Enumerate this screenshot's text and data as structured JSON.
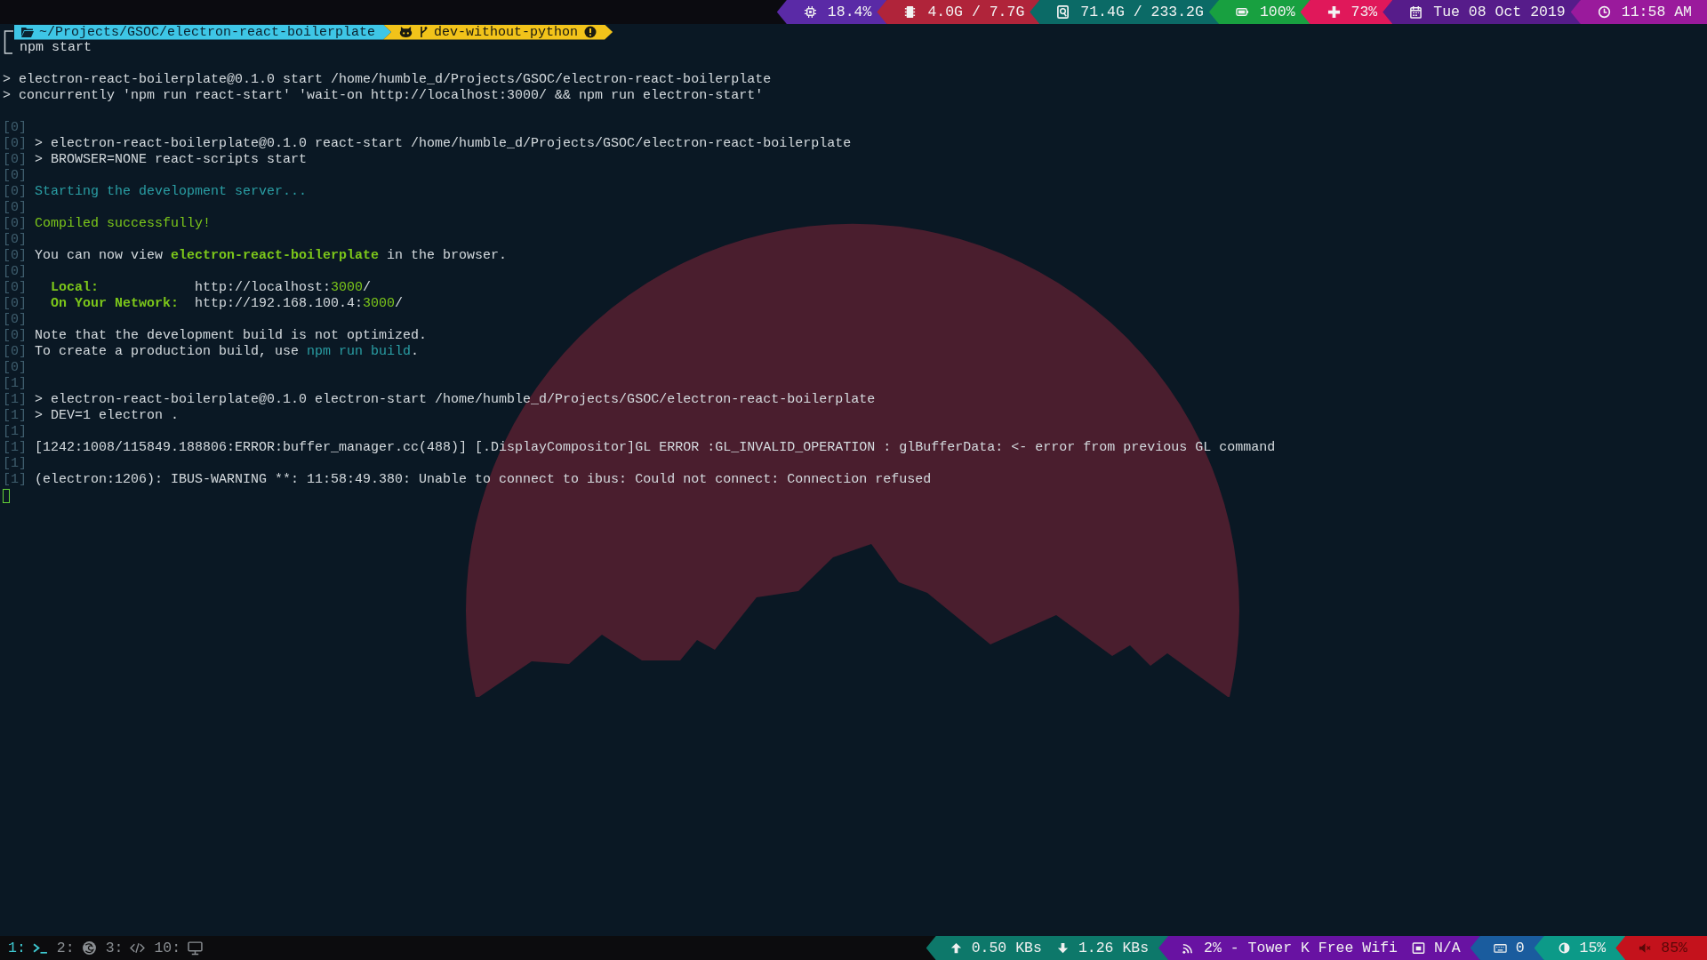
{
  "top_bar": {
    "segments": [
      {
        "kind": "cpu",
        "text": "18.4%",
        "color": "#5a2aa6"
      },
      {
        "kind": "memory",
        "text": "4.0G / 7.7G",
        "color": "#b0243a"
      },
      {
        "kind": "disk",
        "text": "71.4G / 233.2G",
        "color": "#0b6a66"
      },
      {
        "kind": "battery",
        "text": "100%",
        "color": "#18a040"
      },
      {
        "kind": "health",
        "text": "73%",
        "color": "#e0185a"
      },
      {
        "kind": "calendar",
        "text": "Tue 08 Oct 2019",
        "color": "#561c8a"
      },
      {
        "kind": "clock",
        "text": "11:58 AM",
        "color": "#9a1a9c"
      }
    ]
  },
  "prompt": {
    "path": "~/Projects/GSOC/electron-react-boilerplate",
    "branch": "dev-without-python",
    "dirty": true,
    "command": "npm start"
  },
  "terminal": {
    "lines": [
      {
        "kind": "blank"
      },
      {
        "kind": "output",
        "segments": [
          {
            "text": "> electron-react-boilerplate@0.1.0 start /home/humble_d/Projects/GSOC/electron-react-boilerplate",
            "kind": "plain"
          }
        ]
      },
      {
        "kind": "output",
        "segments": [
          {
            "text": "> concurrently 'npm run react-start' 'wait-on http://localhost:3000/ && npm run electron-start'",
            "kind": "plain"
          }
        ]
      },
      {
        "kind": "blank"
      },
      {
        "kind": "output",
        "tag": "[0]"
      },
      {
        "kind": "output",
        "tag": "[0]",
        "segments": [
          {
            "text": "> electron-react-boilerplate@0.1.0 react-start /home/humble_d/Projects/GSOC/electron-react-boilerplate",
            "kind": "plain"
          }
        ]
      },
      {
        "kind": "output",
        "tag": "[0]",
        "segments": [
          {
            "text": "> BROWSER=NONE react-scripts start",
            "kind": "plain"
          }
        ]
      },
      {
        "kind": "output",
        "tag": "[0]"
      },
      {
        "kind": "output",
        "tag": "[0]",
        "segments": [
          {
            "text": "Starting the development server...",
            "kind": "info"
          }
        ]
      },
      {
        "kind": "output",
        "tag": "[0]"
      },
      {
        "kind": "output",
        "tag": "[0]",
        "segments": [
          {
            "text": "Compiled successfully!",
            "kind": "success"
          }
        ]
      },
      {
        "kind": "output",
        "tag": "[0]"
      },
      {
        "kind": "output",
        "tag": "[0]",
        "segments": [
          {
            "text": "You can now view ",
            "kind": "plain"
          },
          {
            "text": "electron-react-boilerplate",
            "kind": "highlight"
          },
          {
            "text": " in the browser.",
            "kind": "plain"
          }
        ]
      },
      {
        "kind": "output",
        "tag": "[0]"
      },
      {
        "kind": "output",
        "tag": "[0]",
        "segments": [
          {
            "text": "  Local:",
            "kind": "highlight"
          },
          {
            "text": "            http://localhost:",
            "kind": "plain"
          },
          {
            "text": "3000",
            "kind": "success"
          },
          {
            "text": "/",
            "kind": "plain"
          }
        ]
      },
      {
        "kind": "output",
        "tag": "[0]",
        "segments": [
          {
            "text": "  On Your Network:",
            "kind": "highlight"
          },
          {
            "text": "  http://192.168.100.4:",
            "kind": "plain"
          },
          {
            "text": "3000",
            "kind": "success"
          },
          {
            "text": "/",
            "kind": "plain"
          }
        ]
      },
      {
        "kind": "output",
        "tag": "[0]"
      },
      {
        "kind": "output",
        "tag": "[0]",
        "segments": [
          {
            "text": "Note that the development build is not optimized.",
            "kind": "plain"
          }
        ]
      },
      {
        "kind": "output",
        "tag": "[0]",
        "segments": [
          {
            "text": "To create a production build, use ",
            "kind": "plain"
          },
          {
            "text": "npm run build",
            "kind": "info"
          },
          {
            "text": ".",
            "kind": "plain"
          }
        ]
      },
      {
        "kind": "output",
        "tag": "[0]"
      },
      {
        "kind": "output",
        "tag": "[1]"
      },
      {
        "kind": "output",
        "tag": "[1]",
        "segments": [
          {
            "text": "> electron-react-boilerplate@0.1.0 electron-start /home/humble_d/Projects/GSOC/electron-react-boilerplate",
            "kind": "plain"
          }
        ]
      },
      {
        "kind": "output",
        "tag": "[1]",
        "segments": [
          {
            "text": "> DEV=1 electron .",
            "kind": "plain"
          }
        ]
      },
      {
        "kind": "output",
        "tag": "[1]"
      },
      {
        "kind": "output",
        "tag": "[1]",
        "segments": [
          {
            "text": "[1242:1008/115849.188806:ERROR:buffer_manager.cc(488)] [.DisplayCompositor]GL ERROR :GL_INVALID_OPERATION : glBufferData: <- error from previous GL command",
            "kind": "plain"
          }
        ]
      },
      {
        "kind": "output",
        "tag": "[1]"
      },
      {
        "kind": "output",
        "tag": "[1]",
        "segments": [
          {
            "text": "(electron:1206): IBUS-WARNING **: 11:58:49.380: Unable to connect to ibus: Could not connect: Connection refused",
            "kind": "plain"
          }
        ]
      },
      {
        "kind": "cursor"
      }
    ]
  },
  "bottom_bar": {
    "workspaces": [
      {
        "label": "1:",
        "kind": "terminal",
        "selected": true
      },
      {
        "label": "2:",
        "kind": "browser",
        "selected": false
      },
      {
        "label": "3:",
        "kind": "code",
        "selected": false
      },
      {
        "label": "10:",
        "kind": "monitor",
        "selected": false
      }
    ],
    "segments": [
      {
        "color": "#0d786a",
        "items": [
          {
            "kind": "upload",
            "text": "0.50 KBs"
          },
          {
            "kind": "download",
            "text": "1.26 KBs"
          }
        ]
      },
      {
        "color": "#6812a2",
        "items": [
          {
            "kind": "wifi",
            "text": "2% - Tower K Free Wifi"
          },
          {
            "kind": "ethernet",
            "text": "N/A"
          }
        ]
      },
      {
        "color": "#1a5c9e",
        "items": [
          {
            "kind": "keyboard",
            "text": "0"
          }
        ]
      },
      {
        "color": "#0c9a88",
        "items": [
          {
            "kind": "brightness",
            "text": "15%"
          }
        ]
      },
      {
        "color": "#c4121c",
        "muted": true,
        "items": [
          {
            "kind": "volume",
            "text": "85%"
          }
        ]
      }
    ]
  }
}
